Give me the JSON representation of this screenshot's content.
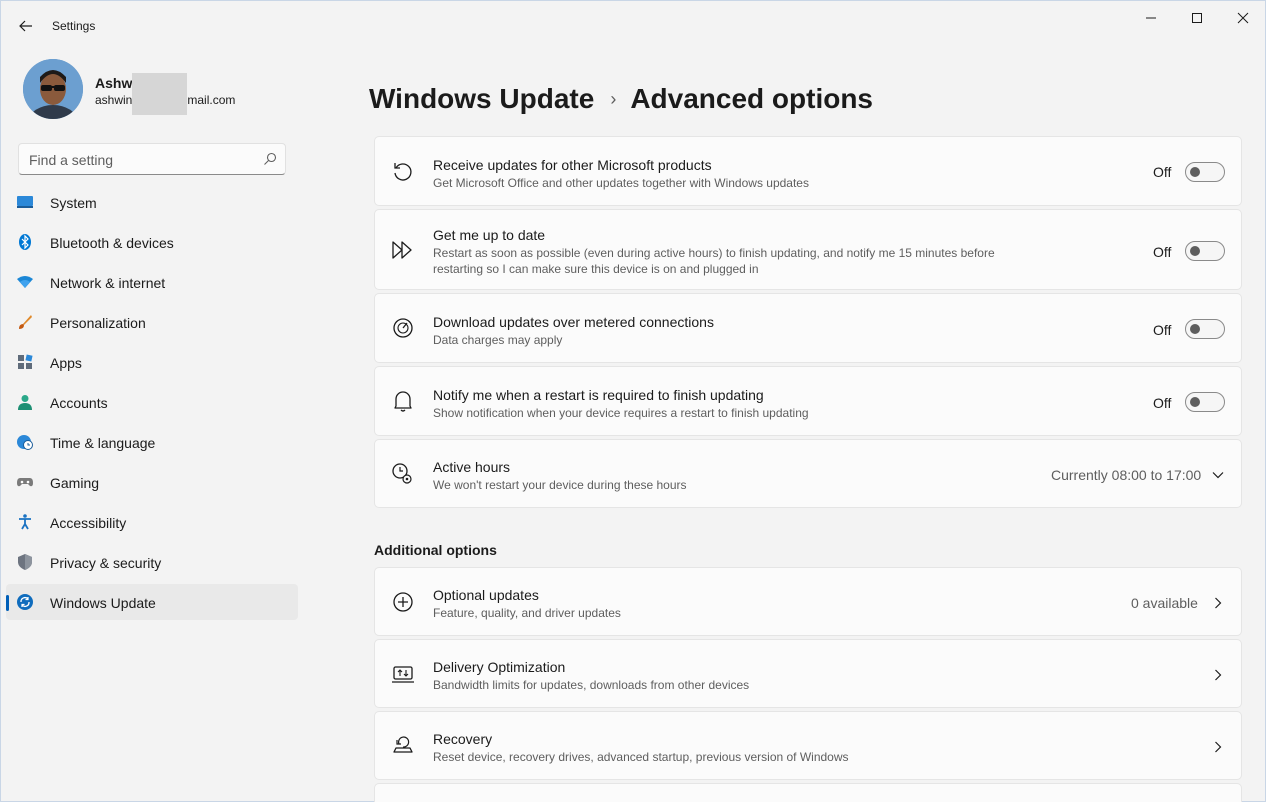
{
  "window": {
    "title": "Settings",
    "controls": [
      "minimize",
      "maximize",
      "close"
    ]
  },
  "profile": {
    "name": "Ashwi",
    "email": "ashwin",
    "email_suffix": "mail.com"
  },
  "search": {
    "placeholder": "Find a setting"
  },
  "sidebar": {
    "items": [
      {
        "label": "System",
        "icon": "system-icon"
      },
      {
        "label": "Bluetooth & devices",
        "icon": "bluetooth-icon"
      },
      {
        "label": "Network & internet",
        "icon": "wifi-icon"
      },
      {
        "label": "Personalization",
        "icon": "brush-icon"
      },
      {
        "label": "Apps",
        "icon": "apps-icon"
      },
      {
        "label": "Accounts",
        "icon": "accounts-icon"
      },
      {
        "label": "Time & language",
        "icon": "globe-clock-icon"
      },
      {
        "label": "Gaming",
        "icon": "gamepad-icon"
      },
      {
        "label": "Accessibility",
        "icon": "accessibility-icon"
      },
      {
        "label": "Privacy & security",
        "icon": "shield-icon"
      },
      {
        "label": "Windows Update",
        "icon": "windows-update-icon",
        "active": true
      }
    ]
  },
  "breadcrumb": {
    "parent": "Windows Update",
    "separator": "›",
    "current": "Advanced options"
  },
  "settings": [
    {
      "title": "Receive updates for other Microsoft products",
      "desc": "Get Microsoft Office and other updates together with Windows updates",
      "state": "Off"
    },
    {
      "title": "Get me up to date",
      "desc": "Restart as soon as possible (even during active hours) to finish updating, and notify me 15 minutes before restarting so I can make sure this device is on and plugged in",
      "state": "Off"
    },
    {
      "title": "Download updates over metered connections",
      "desc": "Data charges may apply",
      "state": "Off"
    },
    {
      "title": "Notify me when a restart is required to finish updating",
      "desc": "Show notification when your device requires a restart to finish updating",
      "state": "Off"
    },
    {
      "title": "Active hours",
      "desc": "We won't restart your device during these hours",
      "value": "Currently 08:00 to 17:00"
    }
  ],
  "additional": {
    "section_title": "Additional options",
    "items": [
      {
        "title": "Optional updates",
        "desc": "Feature, quality, and driver updates",
        "value": "0 available"
      },
      {
        "title": "Delivery Optimization",
        "desc": "Bandwidth limits for updates, downloads from other devices"
      },
      {
        "title": "Recovery",
        "desc": "Reset device, recovery drives, advanced startup, previous version of Windows"
      }
    ]
  },
  "colors": {
    "accent": "#005fb8",
    "background": "#f3f3f3",
    "card": "#fbfbfb"
  }
}
